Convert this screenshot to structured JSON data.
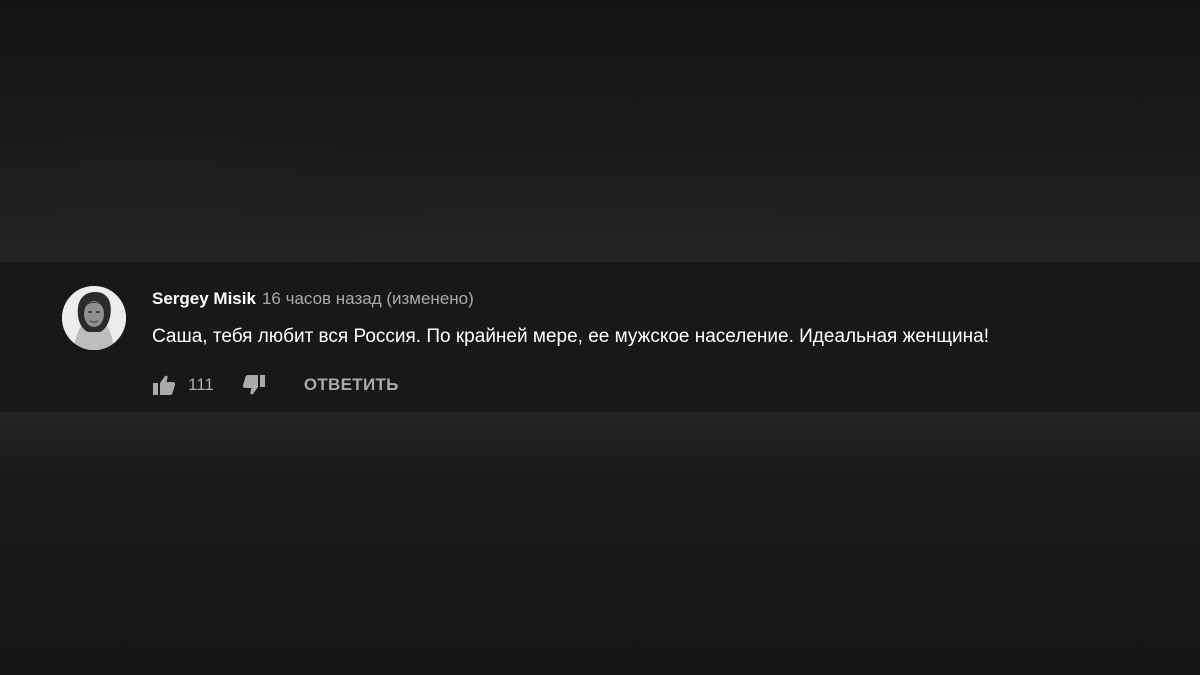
{
  "comment": {
    "author": "Sergey Misik",
    "timestamp": "16 часов назад (изменено)",
    "text": "Саша, тебя любит вся Россия. По крайней мере, ее мужское население. Идеальная женщина!",
    "like_count": "111",
    "reply_label": "ОТВЕТИТЬ",
    "icons": {
      "like": "thumb-up-icon",
      "dislike": "thumb-down-icon"
    }
  },
  "colors": {
    "background": "#181818",
    "author": "#ffffff",
    "meta": "#aaaaaa",
    "text": "#ffffff"
  }
}
